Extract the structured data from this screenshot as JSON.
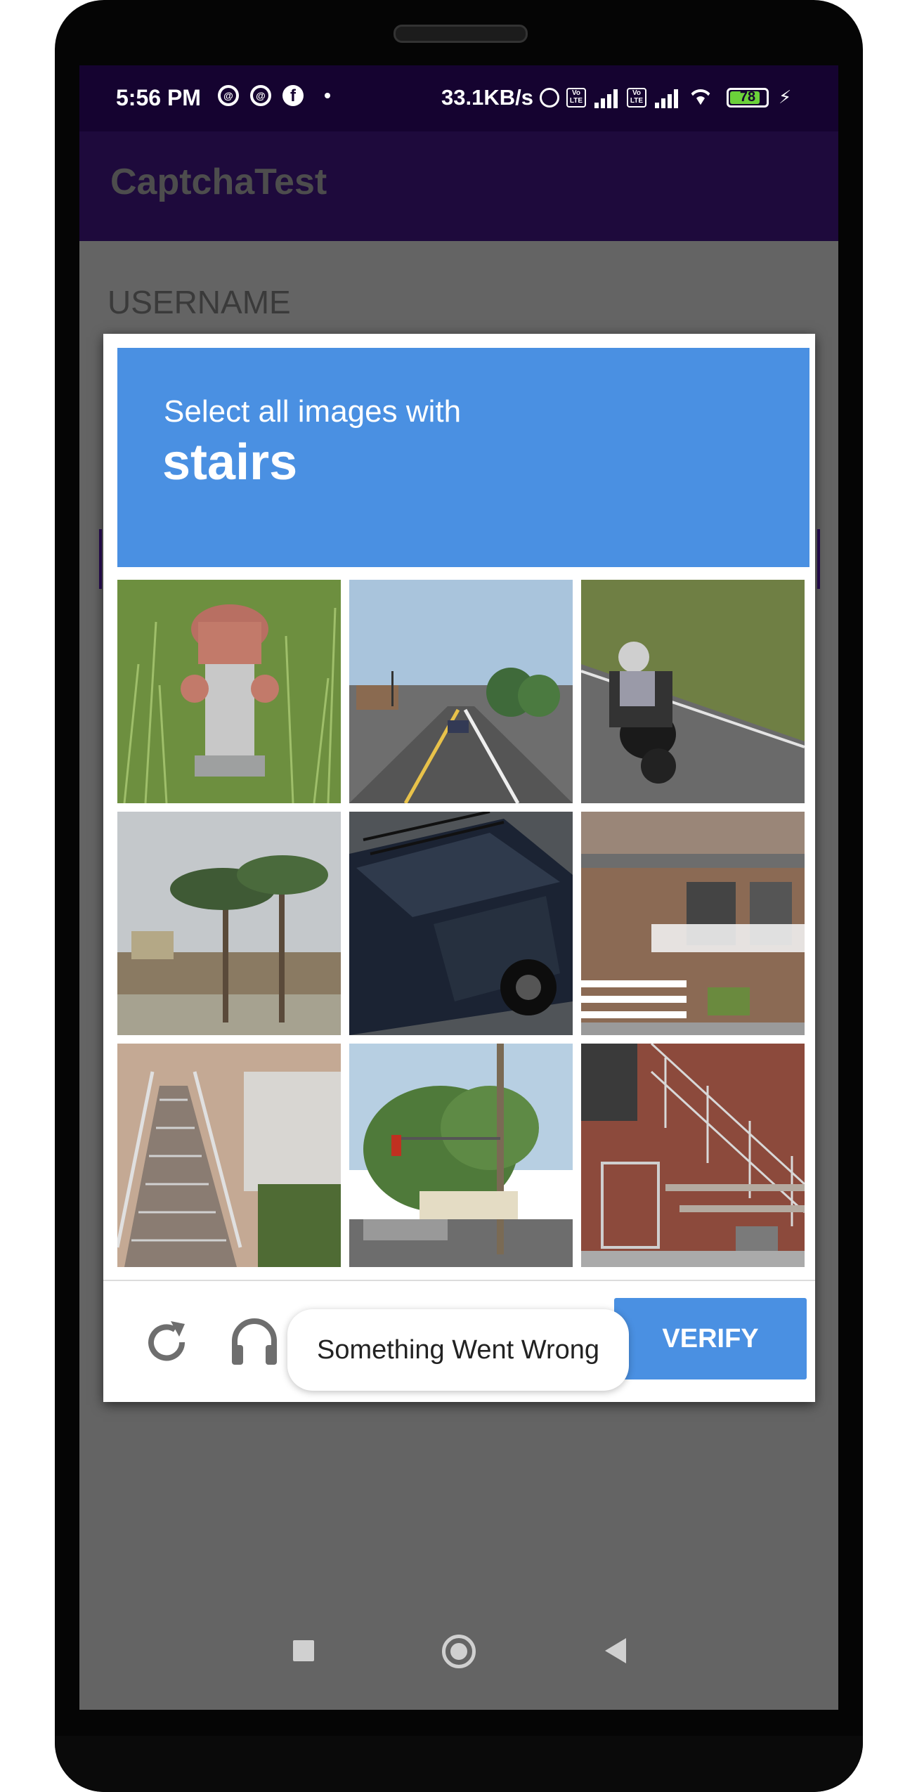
{
  "status_bar": {
    "time": "5:56 PM",
    "network_speed": "33.1KB/s",
    "battery_level": "78",
    "icons_left": [
      "at-sign-icon",
      "at-sign-icon",
      "facebook-icon",
      "dot-icon"
    ],
    "icons_right": [
      "alarm-icon",
      "volte-icon",
      "signal-icon",
      "volte-icon",
      "signal-icon",
      "wifi-icon",
      "battery-icon",
      "charging-bolt-icon"
    ],
    "volte_label": "Vo LTE",
    "bolt": "⚡"
  },
  "app_bar": {
    "title": "CaptchaTest"
  },
  "form": {
    "username_label": "USERNAME"
  },
  "captcha": {
    "prompt": "Select all images with",
    "target": "stairs",
    "tiles": [
      {
        "subject": "fire-hydrant"
      },
      {
        "subject": "street-road"
      },
      {
        "subject": "motorcycle"
      },
      {
        "subject": "palm-trees"
      },
      {
        "subject": "car"
      },
      {
        "subject": "house-porch-stairs"
      },
      {
        "subject": "outdoor-stairs"
      },
      {
        "subject": "street-traffic-light"
      },
      {
        "subject": "brick-stairs"
      }
    ],
    "verify_label": "VERIFY",
    "reload_icon": "reload-icon",
    "audio_icon": "headphones-icon",
    "info_icon": "info-icon"
  },
  "toast": {
    "message": "Something Went Wrong"
  },
  "nav_bar": {
    "recents_icon": "square-recents-icon",
    "home_icon": "circle-home-icon",
    "back_icon": "triangle-back-icon"
  },
  "colors": {
    "status_bar": "#150330",
    "app_bar": "#1e0a3c",
    "scrim": "#646464",
    "captcha_header": "#4a90e2",
    "verify_button": "#4a90e2"
  }
}
